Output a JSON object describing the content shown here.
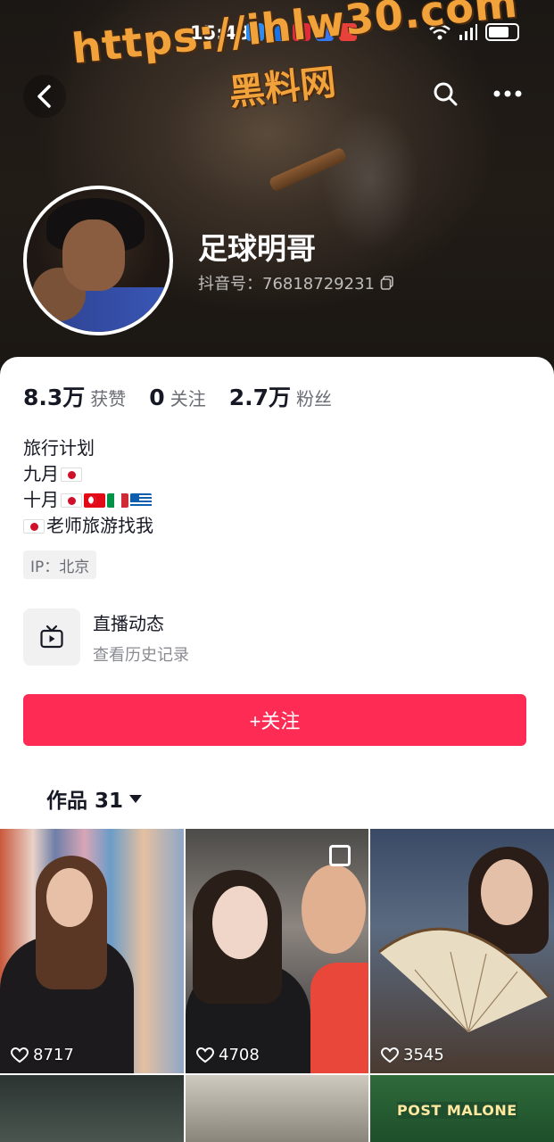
{
  "status_bar": {
    "time": "15:48"
  },
  "watermark": {
    "url": "https://ihlw30.com",
    "text": "黑料网"
  },
  "profile": {
    "nickname": "足球明哥",
    "douyin_id": "抖音号：76818729231"
  },
  "stats": [
    {
      "value": "8.3万",
      "label": "获赞"
    },
    {
      "value": "0",
      "label": "关注"
    },
    {
      "value": "2.7万",
      "label": "粉丝"
    }
  ],
  "bio": {
    "line1": "旅行计划",
    "line2": "九月",
    "line3": "十月",
    "line4": "老师旅游找我"
  },
  "ip": "IP：北京",
  "live": {
    "title": "直播动态",
    "subtitle": "查看历史记录"
  },
  "follow_button": "+关注",
  "works_tab": "作品 31",
  "videos": [
    {
      "likes": "8717"
    },
    {
      "likes": "4708"
    },
    {
      "likes": "3545"
    }
  ],
  "video_overlay_text": "POST MALONE",
  "colors": {
    "accent": "#fe2c55",
    "text": "#161823",
    "muted": "#6b6d75"
  },
  "icons": [
    "back-arrow-icon",
    "search-icon",
    "more-icon",
    "copy-icon",
    "tv-icon",
    "caret-down-icon",
    "heart-icon",
    "multi-image-icon"
  ]
}
